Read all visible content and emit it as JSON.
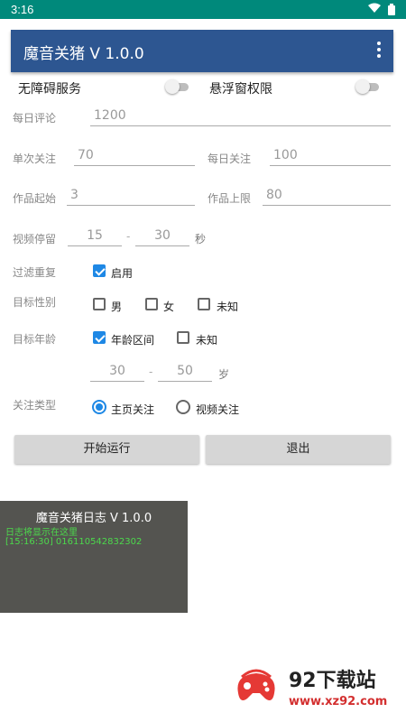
{
  "status": {
    "time": "3:16"
  },
  "appbar": {
    "title": "魔音关猪 V 1.0.0"
  },
  "permissions": {
    "accessibility": "无障碍服务",
    "overlay": "悬浮窗权限"
  },
  "form": {
    "daily_comment_label": "每日评论",
    "daily_comment_value": "1200",
    "single_follow_label": "单次关注",
    "single_follow_value": "70",
    "daily_follow_label": "每日关注",
    "daily_follow_value": "100",
    "work_start_label": "作品起始",
    "work_start_value": "3",
    "work_limit_label": "作品上限",
    "work_limit_value": "80",
    "video_stay_label": "视频停留",
    "video_stay_min": "15",
    "video_stay_sep": "-",
    "video_stay_max": "30",
    "video_stay_unit": "秒",
    "filter_dup_label": "过滤重复",
    "filter_dup_option": "启用",
    "gender_label": "目标性别",
    "gender_male": "男",
    "gender_female": "女",
    "gender_unknown": "未知",
    "age_label": "目标年龄",
    "age_range_option": "年龄区间",
    "age_unknown": "未知",
    "age_min": "30",
    "age_sep": "-",
    "age_max": "50",
    "age_unit": "岁",
    "follow_type_label": "关注类型",
    "follow_home": "主页关注",
    "follow_video": "视频关注"
  },
  "buttons": {
    "start": "开始运行",
    "exit": "退出"
  },
  "log": {
    "title": "魔音关猪日志 V 1.0.0",
    "line1": "日志将显示在这里",
    "line2": "[15:16:30] 016110542832302"
  },
  "watermark": {
    "brand": "92下载站",
    "url": "www.xz92.com"
  },
  "colors": {
    "statusbar": "#00897b",
    "appbar": "#2d5691",
    "accent": "#1e88e5",
    "log_bg": "#545450",
    "log_text": "#4cd94c"
  }
}
